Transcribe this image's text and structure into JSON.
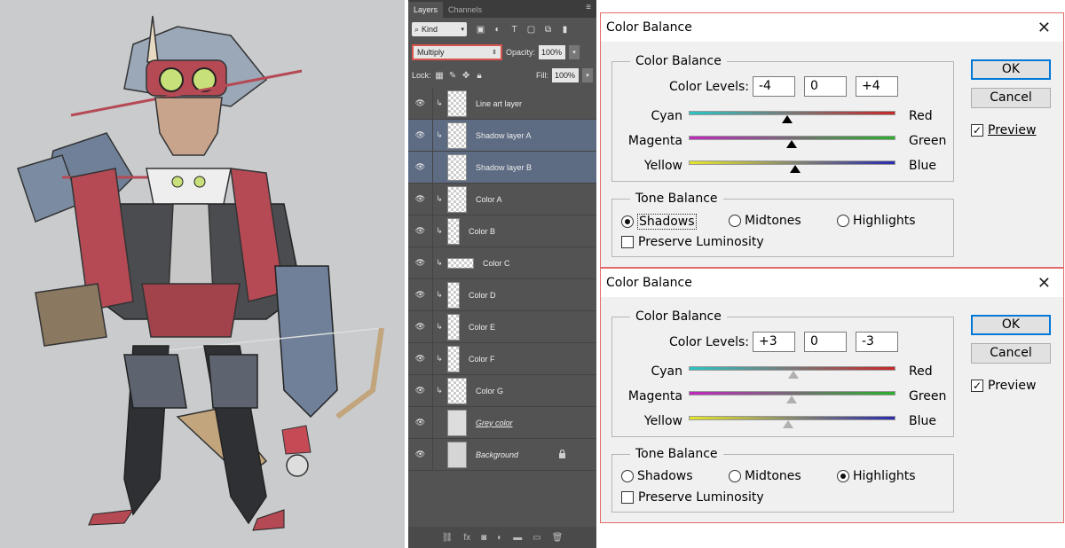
{
  "layers_panel": {
    "tabs": [
      "Layers",
      "Channels"
    ],
    "filter_kind": "Kind",
    "blend_mode": "Multiply",
    "opacity_label": "Opacity:",
    "opacity_value": "100%",
    "lock_label": "Lock:",
    "fill_label": "Fill:",
    "fill_value": "100%",
    "layers": [
      {
        "name": "Line art layer"
      },
      {
        "name": "Shadow layer A"
      },
      {
        "name": "Shadow layer B"
      },
      {
        "name": "Color A"
      },
      {
        "name": "Color B"
      },
      {
        "name": "Color C"
      },
      {
        "name": "Color D"
      },
      {
        "name": "Color E"
      },
      {
        "name": "Color F"
      },
      {
        "name": "Color G"
      },
      {
        "name": "Grey color"
      },
      {
        "name": "Background"
      }
    ]
  },
  "dialog_top": {
    "title": "Color Balance",
    "group_color_balance": "Color Balance",
    "color_levels_label": "Color Levels:",
    "levels": [
      "-4",
      "0",
      "+4"
    ],
    "sliders": [
      {
        "left": "Cyan",
        "right": "Red",
        "value": -4
      },
      {
        "left": "Magenta",
        "right": "Green",
        "value": 0
      },
      {
        "left": "Yellow",
        "right": "Blue",
        "value": 4
      }
    ],
    "group_tone_balance": "Tone Balance",
    "tones": [
      "Shadows",
      "Midtones",
      "Highlights"
    ],
    "selected_tone": "Shadows",
    "preserve_luminosity": "Preserve Luminosity",
    "preserve_checked": false,
    "ok": "OK",
    "cancel": "Cancel",
    "preview": "Preview",
    "preview_checked": true
  },
  "dialog_bottom": {
    "title": "Color Balance",
    "group_color_balance": "Color Balance",
    "color_levels_label": "Color Levels:",
    "levels": [
      "+3",
      "0",
      "-3"
    ],
    "sliders": [
      {
        "left": "Cyan",
        "right": "Red",
        "value": 3
      },
      {
        "left": "Magenta",
        "right": "Green",
        "value": 0
      },
      {
        "left": "Yellow",
        "right": "Blue",
        "value": -3
      }
    ],
    "group_tone_balance": "Tone Balance",
    "tones": [
      "Shadows",
      "Midtones",
      "Highlights"
    ],
    "selected_tone": "Highlights",
    "preserve_luminosity": "Preserve Luminosity",
    "preserve_checked": false,
    "ok": "OK",
    "cancel": "Cancel",
    "preview": "Preview",
    "preview_checked": true
  },
  "colors": {
    "artwork_bg": "#c9cbcd",
    "panel_bg": "#535353",
    "selected_layer": "#5d6b83",
    "dialog_bg": "#f0f0f0",
    "dialog_border": "#e26b6b",
    "ok_border": "#0078d7"
  }
}
